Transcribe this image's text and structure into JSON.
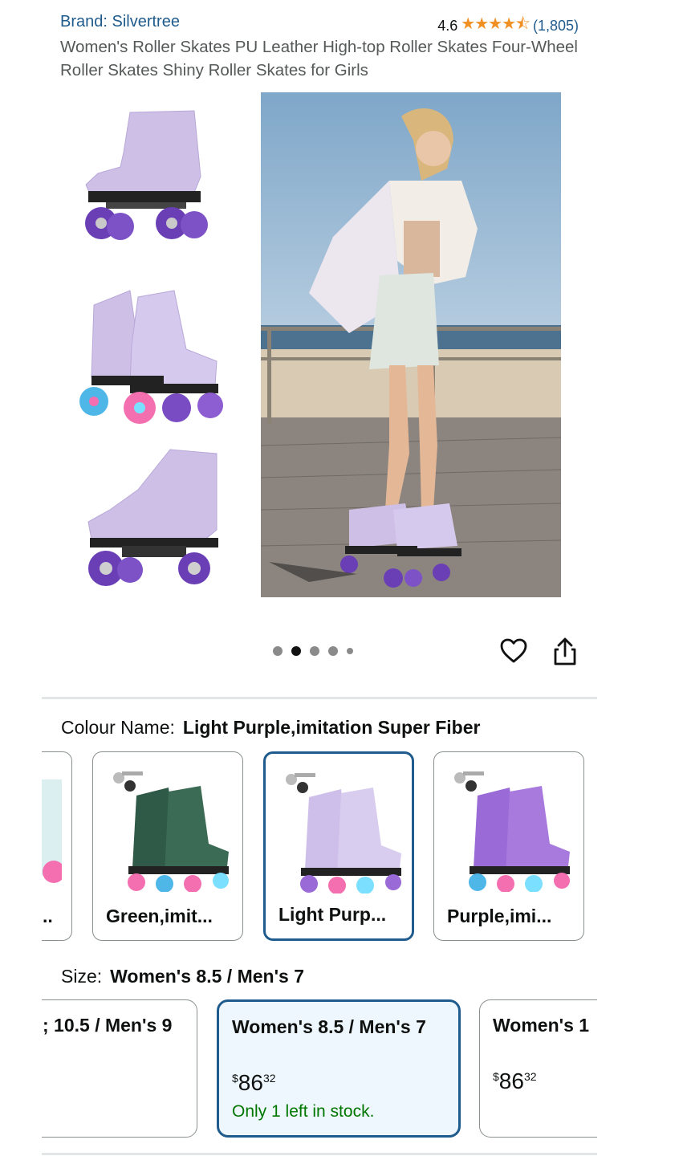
{
  "header": {
    "brand": "Brand: Silvertree",
    "rating_value": "4.6",
    "rating_stars": 4.6,
    "rating_count": "(1,805)",
    "title": "Women's Roller Skates PU Leather High-top Roller Skates Four-Wheel Roller Skates Shiny Roller Skates for Girls"
  },
  "gallery": {
    "thumbnails": [
      "lavender-skate-side-icon",
      "lavender-skates-pair-icon",
      "lavender-skate-angle-icon"
    ],
    "main_image": "model-skating-boardwalk",
    "dots_count": 5,
    "active_dot": 1
  },
  "colour": {
    "label": "Colour Name:",
    "value": "Light Purple,imitation Super Fiber",
    "options": [
      {
        "label": "..",
        "color": "#d9c7f0"
      },
      {
        "label": "Green,imit...",
        "color": "#2f5a47"
      },
      {
        "label": "Light Purp...",
        "color": "#cdbfe9"
      },
      {
        "label": "Purple,imi...",
        "color": "#9a6ad6"
      }
    ],
    "selected_index": 2
  },
  "size": {
    "label": "Size:",
    "value": "Women's 8.5 / Men's 7",
    "options": [
      {
        "label": "; 10.5 / Men's 9",
        "price_whole": "",
        "price_cents": "",
        "stock": ""
      },
      {
        "label": "Women's 8.5 / Men's 7",
        "price_whole": "86",
        "price_cents": "32",
        "stock": "Only 1 left in stock."
      },
      {
        "label": "Women's 1",
        "price_whole": "86",
        "price_cents": "32",
        "stock": ""
      }
    ],
    "currency": "$"
  },
  "colors": {
    "link": "#1f5b8c",
    "star": "#f08f22",
    "in_stock": "#007600",
    "selected_border": "#1f5b8c"
  }
}
